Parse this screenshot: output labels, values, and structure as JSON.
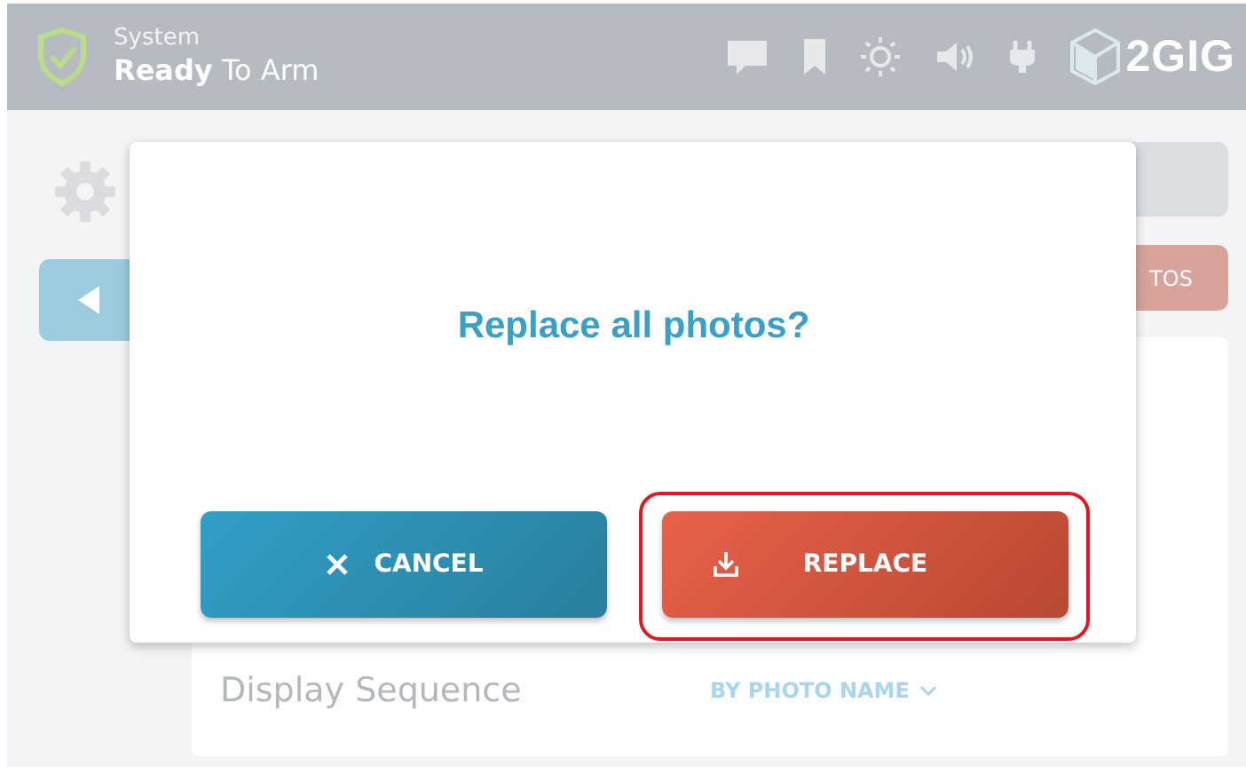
{
  "status_bar": {
    "label": "System",
    "status": "**Ready** To Arm",
    "logo": "2GIG"
  },
  "background": {
    "button_label": "TOS",
    "setting": {
      "label": "Display Sequence",
      "value": "BY PHOTO NAME"
    }
  },
  "dialog": {
    "title": "Replace all photos?",
    "buttons": [
      {
        "kind": "cancel",
        "label": "CANCEL",
        "highlighted": false
      },
      {
        "kind": "replace",
        "label": "REPLACE",
        "highlighted": true
      }
    ]
  }
}
